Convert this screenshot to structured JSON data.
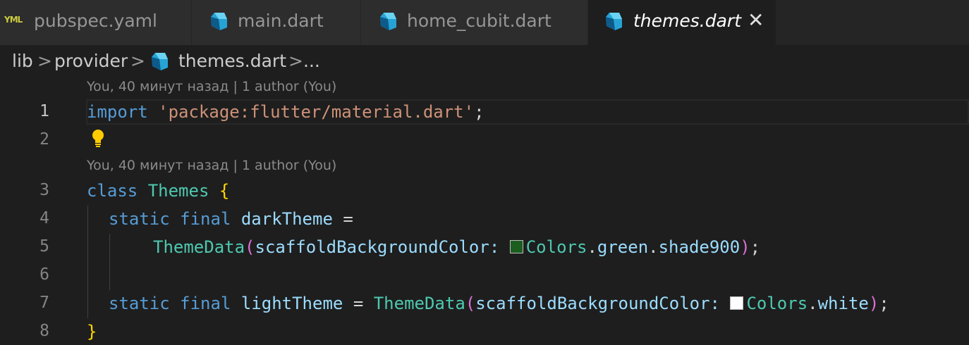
{
  "tabs": [
    {
      "label": "pubspec.yaml",
      "icon": "yaml-file-icon",
      "active": false
    },
    {
      "label": "main.dart",
      "icon": "dart-file-icon",
      "active": false
    },
    {
      "label": "home_cubit.dart",
      "icon": "dart-file-icon",
      "active": false
    },
    {
      "label": "themes.dart",
      "icon": "dart-file-icon",
      "active": true
    }
  ],
  "yaml_badge": "YML",
  "breadcrumb": {
    "parts": [
      "lib",
      "provider",
      "themes.dart",
      "..."
    ],
    "separator": ">"
  },
  "codelens": {
    "first": "You, 40 минут назад | 1 author (You)",
    "second": "You, 40 минут назад | 1 author (You)"
  },
  "lines": {
    "n1": "1",
    "n2": "2",
    "n3": "3",
    "n4": "4",
    "n5": "5",
    "n6": "6",
    "n7": "7",
    "n8": "8"
  },
  "code": {
    "l1_kw": "import",
    "l1_str": "'package:flutter/material.dart'",
    "l1_end": ";",
    "l3_kw": "class",
    "l3_name": "Themes",
    "l3_brace": "{",
    "l4_static": "static",
    "l4_final": "final",
    "l4_name": "darkTheme",
    "l4_eq": "=",
    "l5_type": "ThemeData",
    "l5_open": "(",
    "l5_param": "scaffoldBackgroundColor:",
    "l5_colors": "Colors",
    "l5_dot1": ".",
    "l5_green": "green",
    "l5_dot2": ".",
    "l5_shade": "shade900",
    "l5_close": ")",
    "l5_end": ";",
    "l7_static": "static",
    "l7_final": "final",
    "l7_name": "lightTheme",
    "l7_eq": "=",
    "l7_type": "ThemeData",
    "l7_open": "(",
    "l7_param": "scaffoldBackgroundColor:",
    "l7_colors": "Colors",
    "l7_dot": ".",
    "l7_white": "white",
    "l7_close": ")",
    "l7_end": ";",
    "l8_brace": "}"
  },
  "swatches": {
    "green_shade900": "#1b5e20",
    "white": "#ffffff"
  },
  "colors": {
    "keyword": "#569cd6",
    "string": "#ce9178",
    "type": "#4ec9b0",
    "variable": "#9cdcfe",
    "bracket1": "#ffd700",
    "bracket2": "#da70d6"
  }
}
